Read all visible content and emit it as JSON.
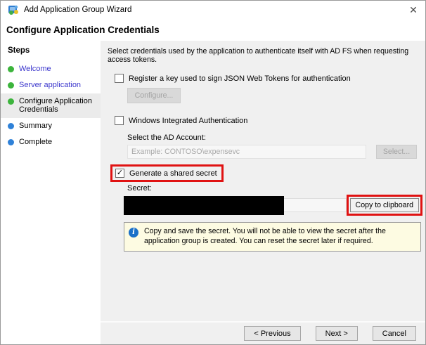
{
  "window": {
    "title": "Add Application Group Wizard"
  },
  "icons": {
    "close": "✕",
    "check": "✓",
    "info": "i"
  },
  "page": {
    "heading": "Configure Application Credentials"
  },
  "sidebar": {
    "title": "Steps",
    "items": [
      {
        "label": "Welcome",
        "state": "done"
      },
      {
        "label": "Server application",
        "state": "done"
      },
      {
        "label": "Configure Application Credentials",
        "state": "current"
      },
      {
        "label": "Summary",
        "state": "pending"
      },
      {
        "label": "Complete",
        "state": "pending"
      }
    ]
  },
  "content": {
    "intro": "Select credentials used by the application to authenticate itself with AD FS when requesting access tokens.",
    "register_key": {
      "label": "Register a key used to sign JSON Web Tokens for authentication",
      "checked": false,
      "configure_label": "Configure..."
    },
    "windows_auth": {
      "label": "Windows Integrated Authentication",
      "checked": false,
      "account_label": "Select the AD Account:",
      "account_placeholder": "Example: CONTOSO\\expensevc",
      "select_label": "Select..."
    },
    "shared_secret": {
      "label": "Generate a shared secret",
      "checked": true,
      "secret_label": "Secret:",
      "copy_label": "Copy to clipboard"
    },
    "note": "Copy and save the secret.  You will not be able to view the secret after the application group is created.  You can reset the secret later if required."
  },
  "footer": {
    "previous_label": "< Previous",
    "next_label": "Next >",
    "cancel_label": "Cancel"
  },
  "colors": {
    "highlight_red": "#e01212",
    "note_bg": "#fdfbe2",
    "info_blue": "#1a70c8",
    "step_done_green": "#3cb43c",
    "step_pending_blue": "#2f81d8",
    "link_blue": "#3a35cc"
  }
}
